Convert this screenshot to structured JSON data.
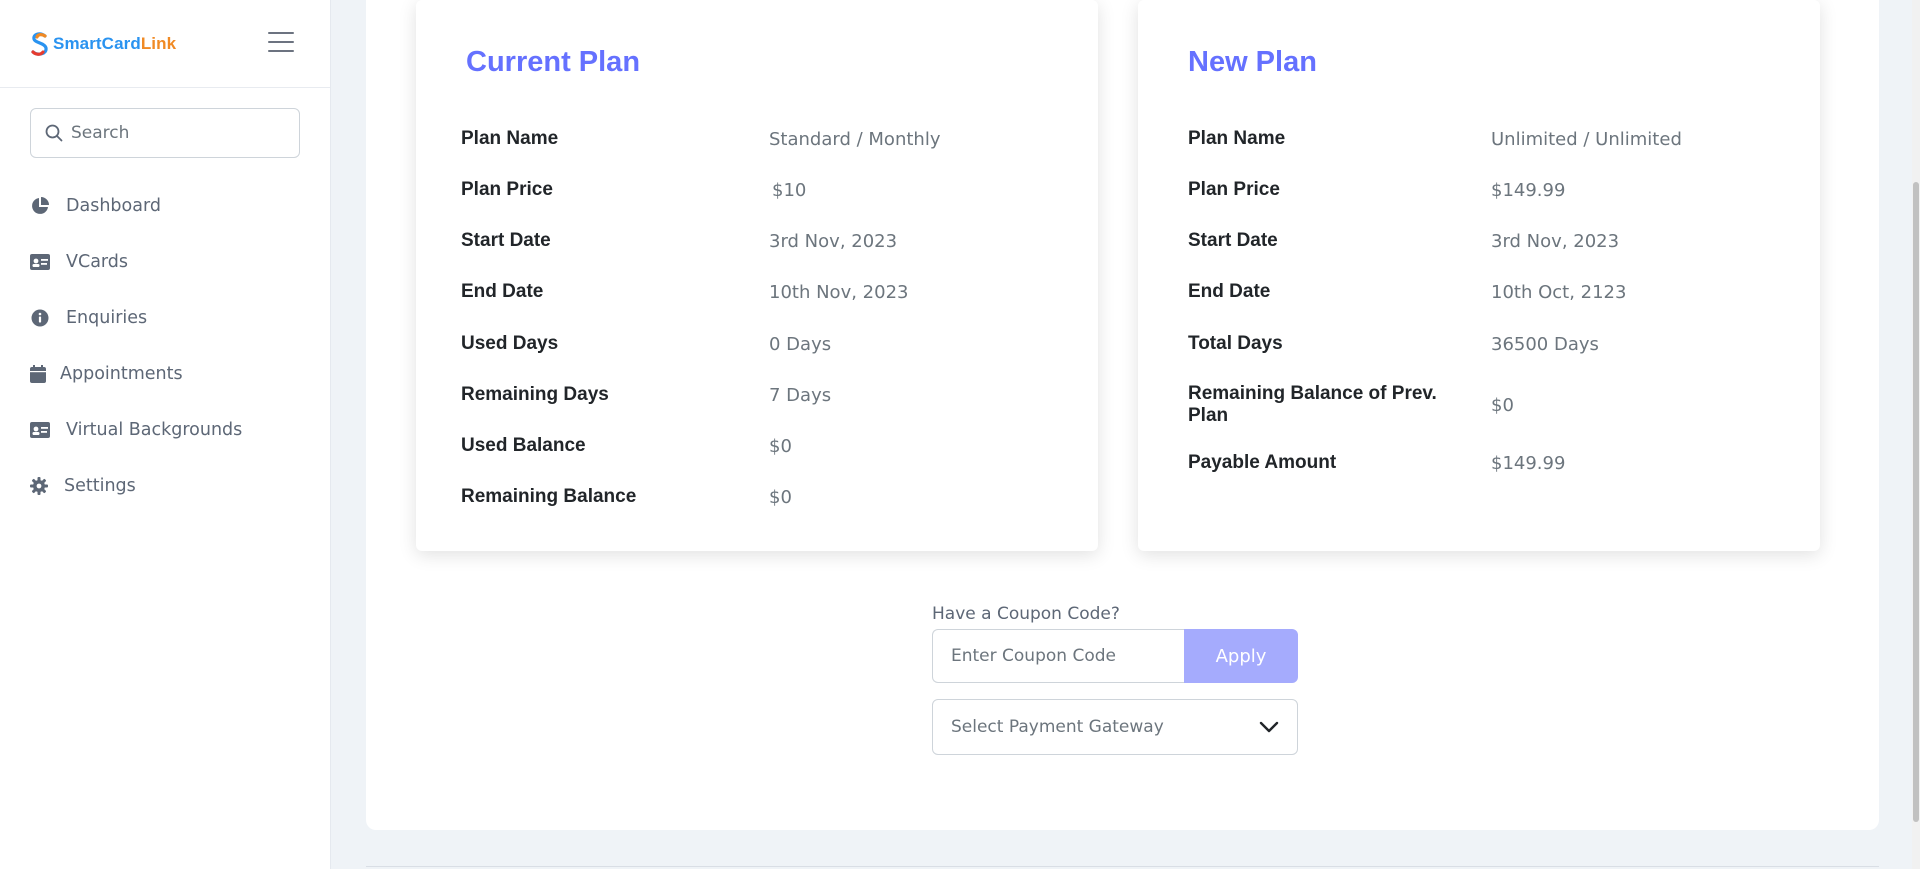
{
  "brand": {
    "part1": "SmartCard",
    "part2": "Link",
    "color1": "#2a93f0",
    "color2": "#f08a24"
  },
  "search": {
    "placeholder": "Search"
  },
  "sidebar": {
    "items": [
      {
        "label": "Dashboard",
        "icon": "pie-chart-icon"
      },
      {
        "label": "VCards",
        "icon": "id-card-icon"
      },
      {
        "label": "Enquiries",
        "icon": "info-circle-icon"
      },
      {
        "label": "Appointments",
        "icon": "calendar-icon"
      },
      {
        "label": "Virtual Backgrounds",
        "icon": "id-card-icon"
      },
      {
        "label": "Settings",
        "icon": "gear-icon"
      }
    ]
  },
  "current_plan": {
    "title": "Current Plan",
    "rows": [
      {
        "label": "Plan Name",
        "value": "Standard / Monthly"
      },
      {
        "label": "Plan Price",
        "value": "$10"
      },
      {
        "label": "Start Date",
        "value": "3rd Nov, 2023"
      },
      {
        "label": "End Date",
        "value": "10th Nov, 2023"
      },
      {
        "label": "Used Days",
        "value": "0 Days"
      },
      {
        "label": "Remaining Days",
        "value": "7 Days"
      },
      {
        "label": "Used Balance",
        "value": "$0"
      },
      {
        "label": "Remaining Balance",
        "value": "$0"
      }
    ]
  },
  "new_plan": {
    "title": "New Plan",
    "rows": [
      {
        "label": "Plan Name",
        "value": "Unlimited / Unlimited"
      },
      {
        "label": "Plan Price",
        "value": "$149.99"
      },
      {
        "label": "Start Date",
        "value": "3rd Nov, 2023"
      },
      {
        "label": "End Date",
        "value": "10th Oct, 2123"
      },
      {
        "label": "Total Days",
        "value": "36500 Days"
      },
      {
        "label": "Remaining Balance of Prev. Plan",
        "value": "$0"
      },
      {
        "label": "Payable Amount",
        "value": "$149.99"
      }
    ]
  },
  "coupon": {
    "label": "Have a Coupon Code?",
    "placeholder": "Enter Coupon Code",
    "apply_label": "Apply"
  },
  "gateway": {
    "placeholder": "Select Payment Gateway"
  },
  "colors": {
    "accent": "#6571ff",
    "apply_button": "#a5abfd",
    "background": "#eff3f7"
  }
}
